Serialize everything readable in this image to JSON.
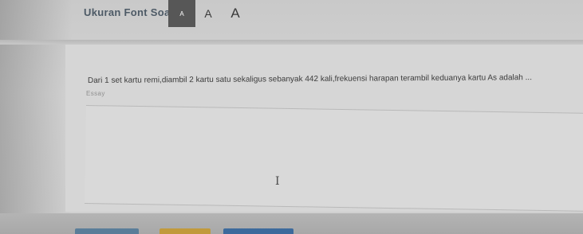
{
  "font_size": {
    "label": "Ukuran Font Soal:",
    "small": "A",
    "medium": "A",
    "large": "A",
    "selected": "small"
  },
  "question": {
    "text": "Dari 1 set kartu remi,diambil 2 kartu satu sekaligus sebanyak 442 kali,frekuensi harapan terambil keduanya kartu As adalah ...",
    "type_label": "Essay"
  },
  "answer": {
    "value": "",
    "cursor_glyph": "I"
  },
  "colors": {
    "selected_font_btn": "#575757",
    "prev_button": "#5a7d99",
    "mark_button": "#c19a3c",
    "next_button": "#3d6a9c"
  }
}
